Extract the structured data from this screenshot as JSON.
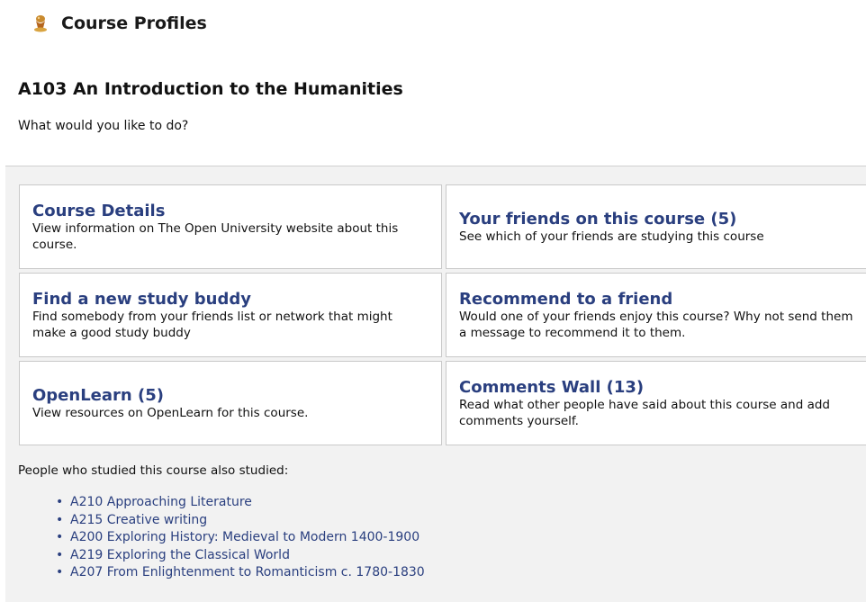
{
  "header": {
    "title": "Course Profiles",
    "icon": "course-profiles-icon"
  },
  "course": {
    "title": "A103 An Introduction to the Humanities",
    "question": "What would you like to do?"
  },
  "options": [
    {
      "title": "Course Details",
      "description": "View information on The Open University website about this course."
    },
    {
      "title": "Your friends on this course (5)",
      "description": "See which of your friends are studying this course"
    },
    {
      "title": "Find a new study buddy",
      "description": "Find somebody from your friends list or network that might make a good study buddy"
    },
    {
      "title": "Recommend to a friend",
      "description": "Would one of your friends enjoy this course? Why not send them a message to recommend it to them."
    },
    {
      "title": "OpenLearn (5)",
      "description": "View resources on OpenLearn for this course."
    },
    {
      "title": "Comments Wall (13)",
      "description": "Read what other people have said about this course and add comments yourself."
    }
  ],
  "also_studied": {
    "heading": "People who studied this course also studied:",
    "bullet": "•",
    "items": [
      "A210 Approaching Literature",
      "A215 Creative writing",
      "A200 Exploring History: Medieval to Modern 1400-1900",
      "A219 Exploring the Classical World",
      "A207 From Enlightenment to Romanticism c. 1780-1830"
    ]
  },
  "colors": {
    "link": "#2a3f7f",
    "panel_bg": "#f2f2f2",
    "card_border": "#c9c9c9"
  }
}
